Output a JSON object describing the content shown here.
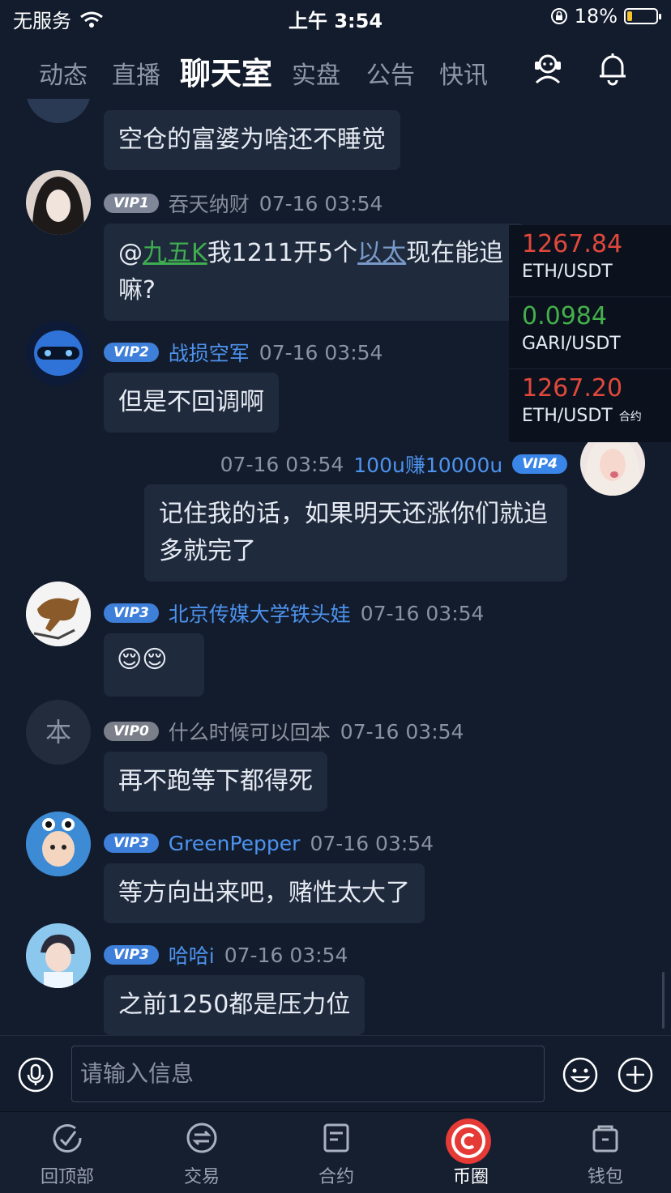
{
  "status": {
    "carrier": "无服务",
    "time": "上午 3:54",
    "battery_pct": "18%",
    "battery_level": 0.18
  },
  "tabs": [
    {
      "label": "动态"
    },
    {
      "label": "直播"
    },
    {
      "label": "聊天室",
      "active": true
    },
    {
      "label": "实盘"
    },
    {
      "label": "公告"
    },
    {
      "label": "快讯"
    }
  ],
  "header_icons": [
    "customer-service-icon",
    "bell-icon"
  ],
  "messages": [
    {
      "side": "left",
      "text": "空仓的富婆为啥还不睡觉"
    },
    {
      "side": "left",
      "vip": "VIP1",
      "user": "吞天纳财",
      "time": "07-16 03:54",
      "mention": "九五K",
      "text_a": "我1211开5个",
      "link_word": "以太",
      "text_b": "现在能追嘛?"
    },
    {
      "side": "left",
      "vip": "VIP2",
      "user": "战损空军",
      "time": "07-16 03:54",
      "text": "但是不回调啊"
    },
    {
      "side": "right",
      "vip": "VIP4",
      "user": "100u赚10000u",
      "time": "07-16 03:54",
      "text": "记住我的话，如果明天还涨你们就追多就完了"
    },
    {
      "side": "left",
      "vip": "VIP3",
      "user": "北京传媒大学铁头娃",
      "time": "07-16 03:54",
      "text": "😌😌"
    },
    {
      "side": "left",
      "vip": "VIP0",
      "user": "什么时候可以回本",
      "time": "07-16 03:54",
      "avatar_char": "本",
      "text": "再不跑等下都得死"
    },
    {
      "side": "left",
      "vip": "VIP3",
      "user": "GreenPepper",
      "time": "07-16 03:54",
      "text": "等方向出来吧，赌性太大了"
    },
    {
      "side": "left",
      "vip": "VIP3",
      "user": "哈哈i",
      "time": "07-16 03:54",
      "text": "之前1250都是压力位"
    }
  ],
  "ticker": [
    {
      "price": "1267.84",
      "pair": "ETH/USDT",
      "color": "#e0483c"
    },
    {
      "price": "0.0984",
      "pair": "GARI/USDT",
      "color": "#43b04a"
    },
    {
      "price": "1267.20",
      "pair": "ETH/USDT",
      "tag": "合约",
      "color": "#e0483c"
    }
  ],
  "input": {
    "placeholder": "请输入信息"
  },
  "nav": [
    {
      "label": "回顶部",
      "icon": "back-to-top-icon"
    },
    {
      "label": "交易",
      "icon": "exchange-icon"
    },
    {
      "label": "合约",
      "icon": "contract-icon"
    },
    {
      "label": "币圈",
      "icon": "coin-circle-icon",
      "active": true
    },
    {
      "label": "钱包",
      "icon": "wallet-icon"
    }
  ]
}
